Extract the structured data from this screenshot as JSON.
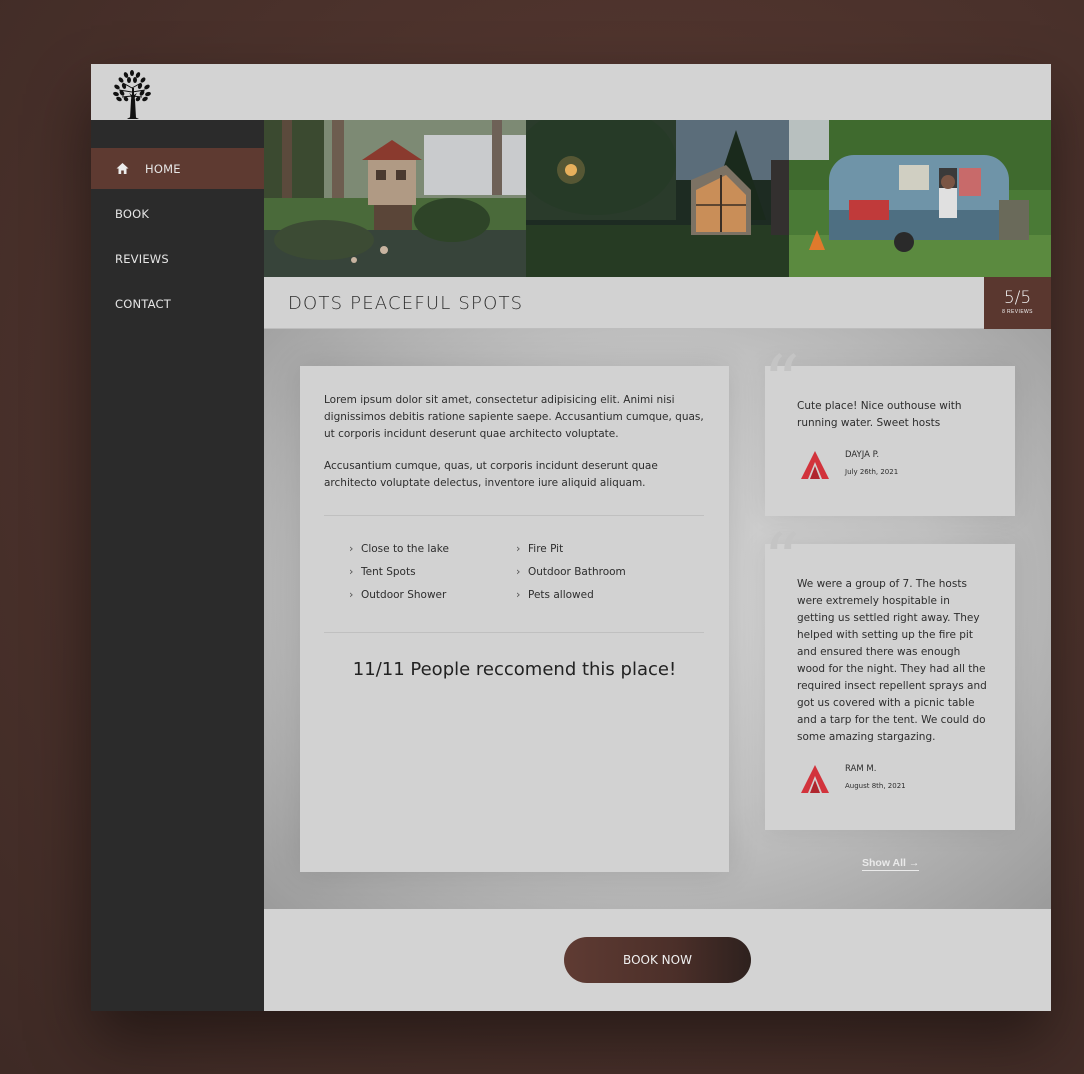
{
  "nav": {
    "items": [
      {
        "label": "HOME",
        "active": true
      },
      {
        "label": "BOOK",
        "active": false
      },
      {
        "label": "REVIEWS",
        "active": false
      },
      {
        "label": "CONTACT",
        "active": false
      }
    ]
  },
  "photos": [
    "fairy-house",
    "a-frame-cabin",
    "vintage-caravan"
  ],
  "listing": {
    "title": "DOTS PEACEFUL SPOTS",
    "rating": "5/5",
    "review_count": "8 REVIEWS",
    "description": [
      "Lorem ipsum dolor sit amet, consectetur adipisicing elit. Animi nisi dignissimos debitis ratione sapiente saepe. Accusantium cumque, quas, ut corporis incidunt deserunt quae architecto voluptate.",
      "Accusantium cumque, quas, ut corporis incidunt deserunt quae architecto voluptate delectus, inventore iure aliquid aliquam."
    ],
    "amenities": [
      "Close to the lake",
      "Tent Spots",
      "Outdoor Shower",
      "Fire Pit",
      "Outdoor Bathroom",
      "Pets allowed"
    ],
    "recommend": "11/11 People reccomend this place!"
  },
  "reviews": [
    {
      "text": "Cute place! Nice outhouse with running water. Sweet hosts",
      "name": "DAYJA P.",
      "date": "July 26th, 2021"
    },
    {
      "text": "We were a group of 7. The hosts were extremely hospitable in getting us settled right away. They helped with setting up the fire pit and ensured there was enough wood for the night. They had all the required insect repellent sprays and got us covered with a picnic table and a tarp for the tent. We could do some amazing stargazing.",
      "name": "RAM M.",
      "date": "August 8th, 2021"
    }
  ],
  "show_all": "Show All →",
  "book_now": "BOOK NOW",
  "colors": {
    "accent": "#5e3a31",
    "sidebar": "#2b2b2b",
    "panel": "#d2d2d2",
    "reviewer_logo": "#d2333c"
  }
}
